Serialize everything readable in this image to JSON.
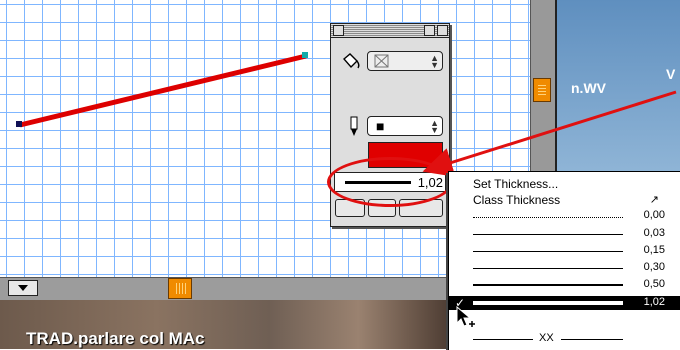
{
  "canvas": {
    "line_color": "#dd0000",
    "grid_color": "#7fb6ff"
  },
  "background_window": {
    "title_fragment": "n.WV",
    "title_fragment_2": "V"
  },
  "photo_window": {
    "title": "TRAD.parlare col MAc"
  },
  "palette": {
    "fill_icon": "paint-bucket-icon",
    "fill_pattern_icon": "none-pattern-icon",
    "pen_icon": "pen-icon",
    "pen_color_label": "■",
    "color": "#e00000",
    "thickness_value": "1,02"
  },
  "thickness_menu": {
    "set_thickness": "Set Thickness...",
    "class_thickness": "Class Thickness",
    "items": [
      "0,00",
      "0,03",
      "0,15",
      "0,30",
      "0,50",
      "1,02"
    ],
    "selected": "1,02",
    "last_item": "XX"
  },
  "annotation": {
    "color": "#e01010"
  }
}
